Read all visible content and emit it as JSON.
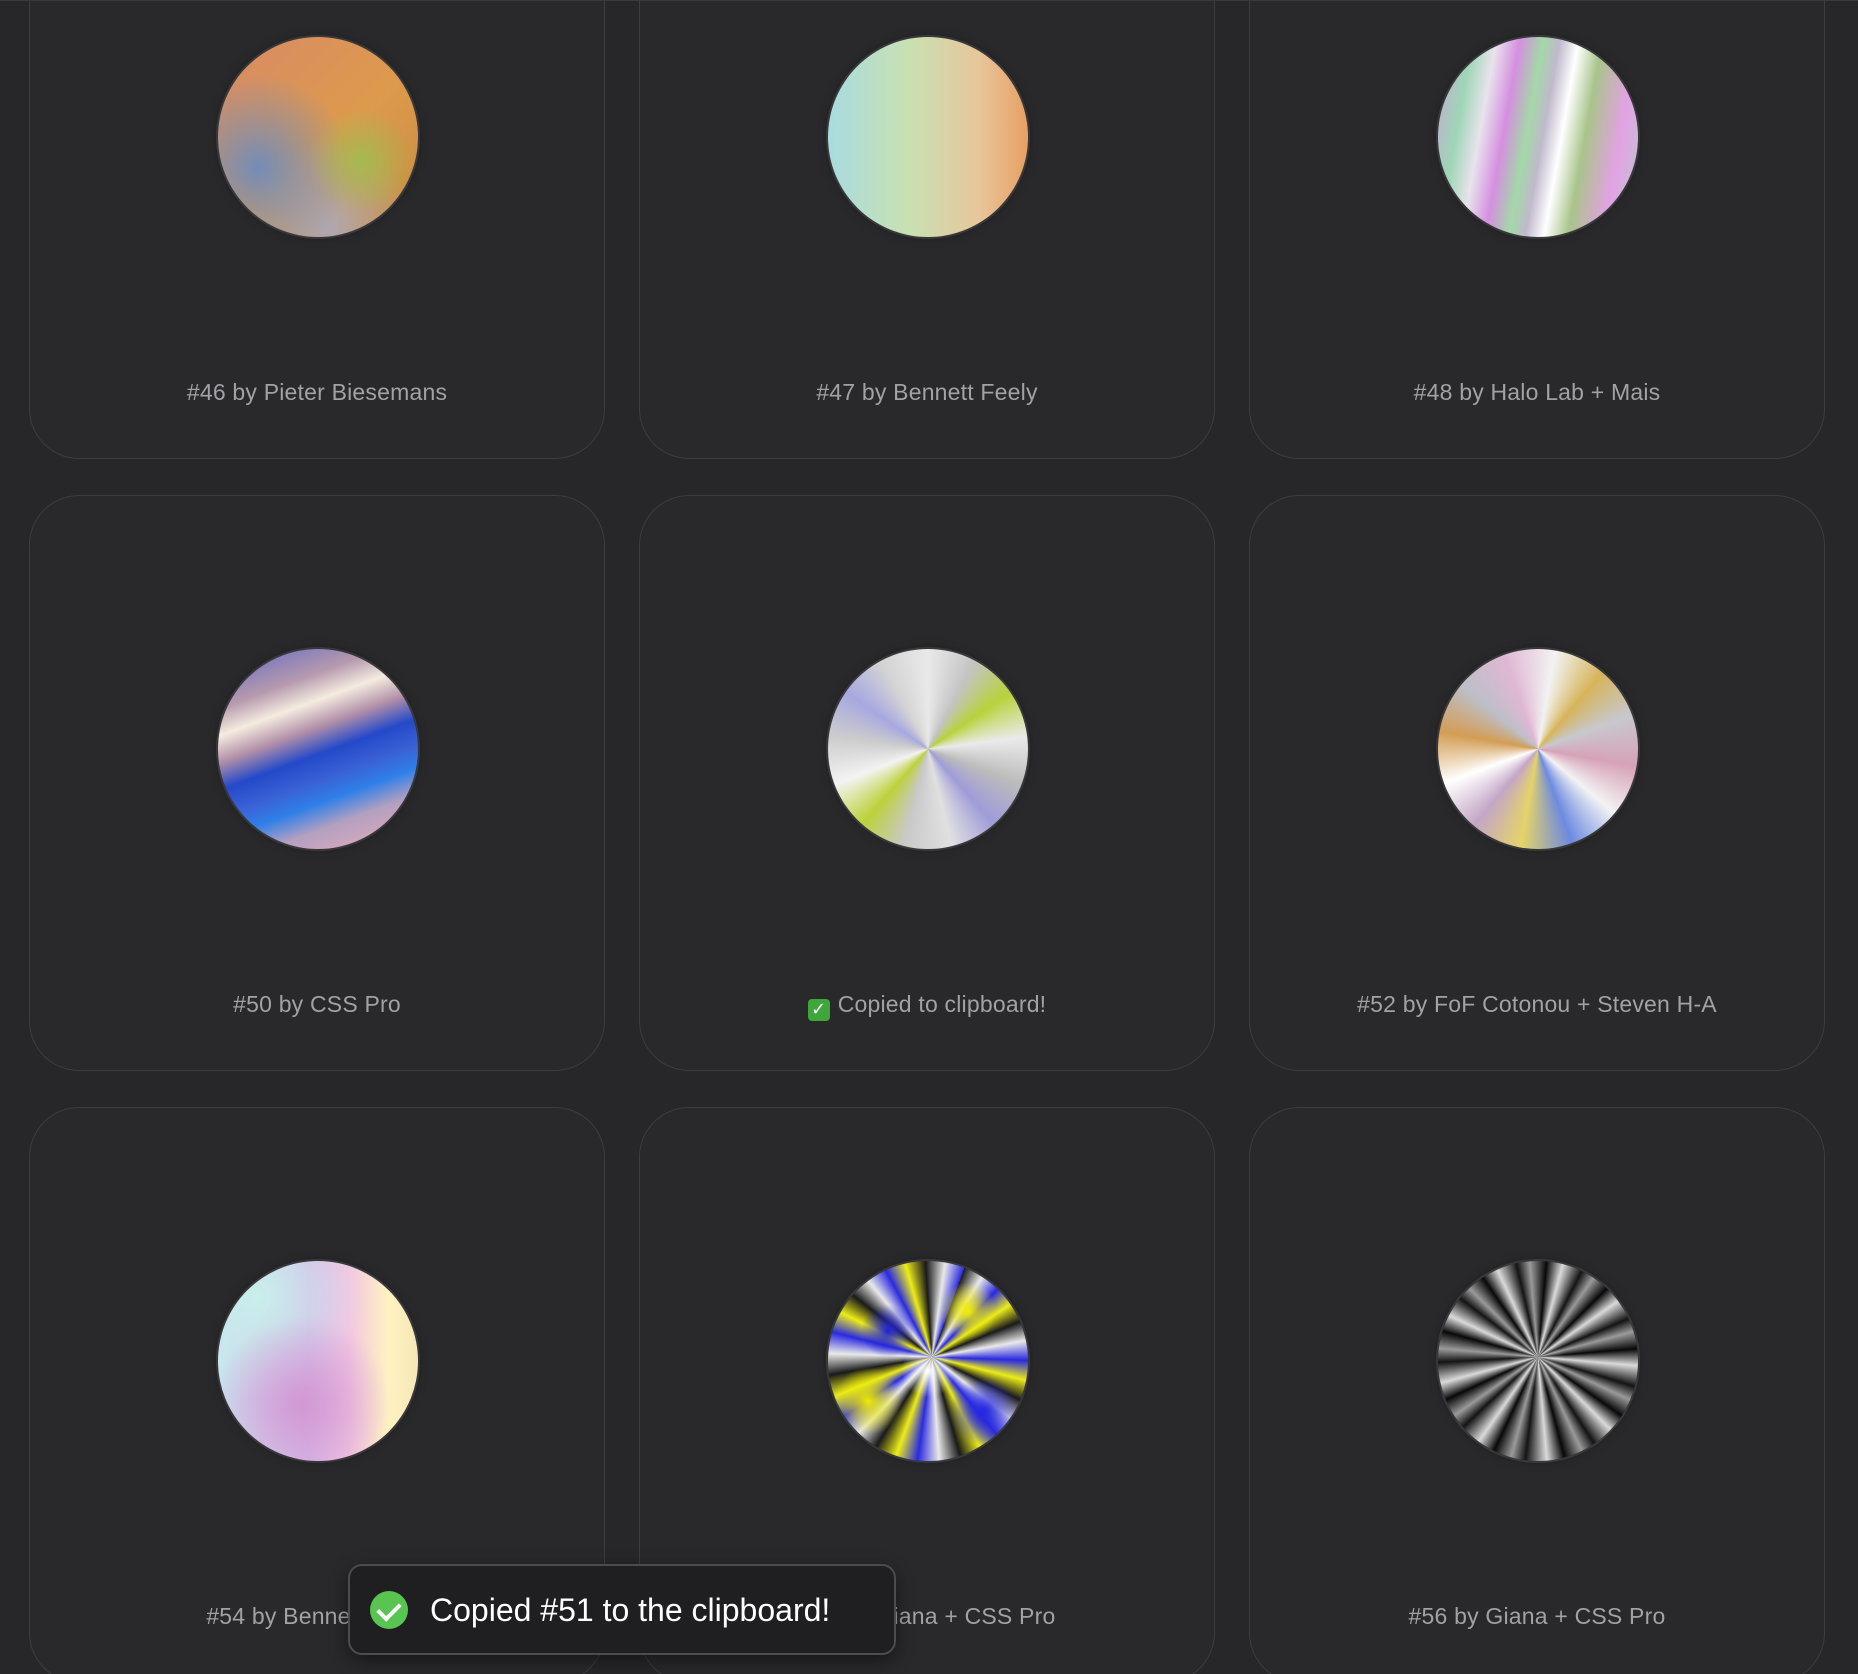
{
  "cards": [
    {
      "caption": "#46 by Pieter Biesemans"
    },
    {
      "caption": "#47 by Bennett Feely"
    },
    {
      "caption": "#48 by Halo Lab + Mais"
    },
    {
      "caption": "#50 by CSS Pro"
    },
    {
      "caption": "Copied to clipboard!",
      "caption_icon": "check-mark-button-emoji"
    },
    {
      "caption": "#52 by FoF Cotonou + Steven H-A"
    },
    {
      "caption": "#54 by Bennett Feely"
    },
    {
      "caption": "#55 by Giana + CSS Pro"
    },
    {
      "caption": "#56 by Giana + CSS Pro"
    }
  ],
  "toast": {
    "message": "Copied #51 to the clipboard!",
    "icon": "check-circle-icon",
    "accent": "#59c551"
  },
  "theme": {
    "background": "#27272a",
    "card_border": "#3c3c41",
    "caption_color": "#a1a1a6"
  }
}
